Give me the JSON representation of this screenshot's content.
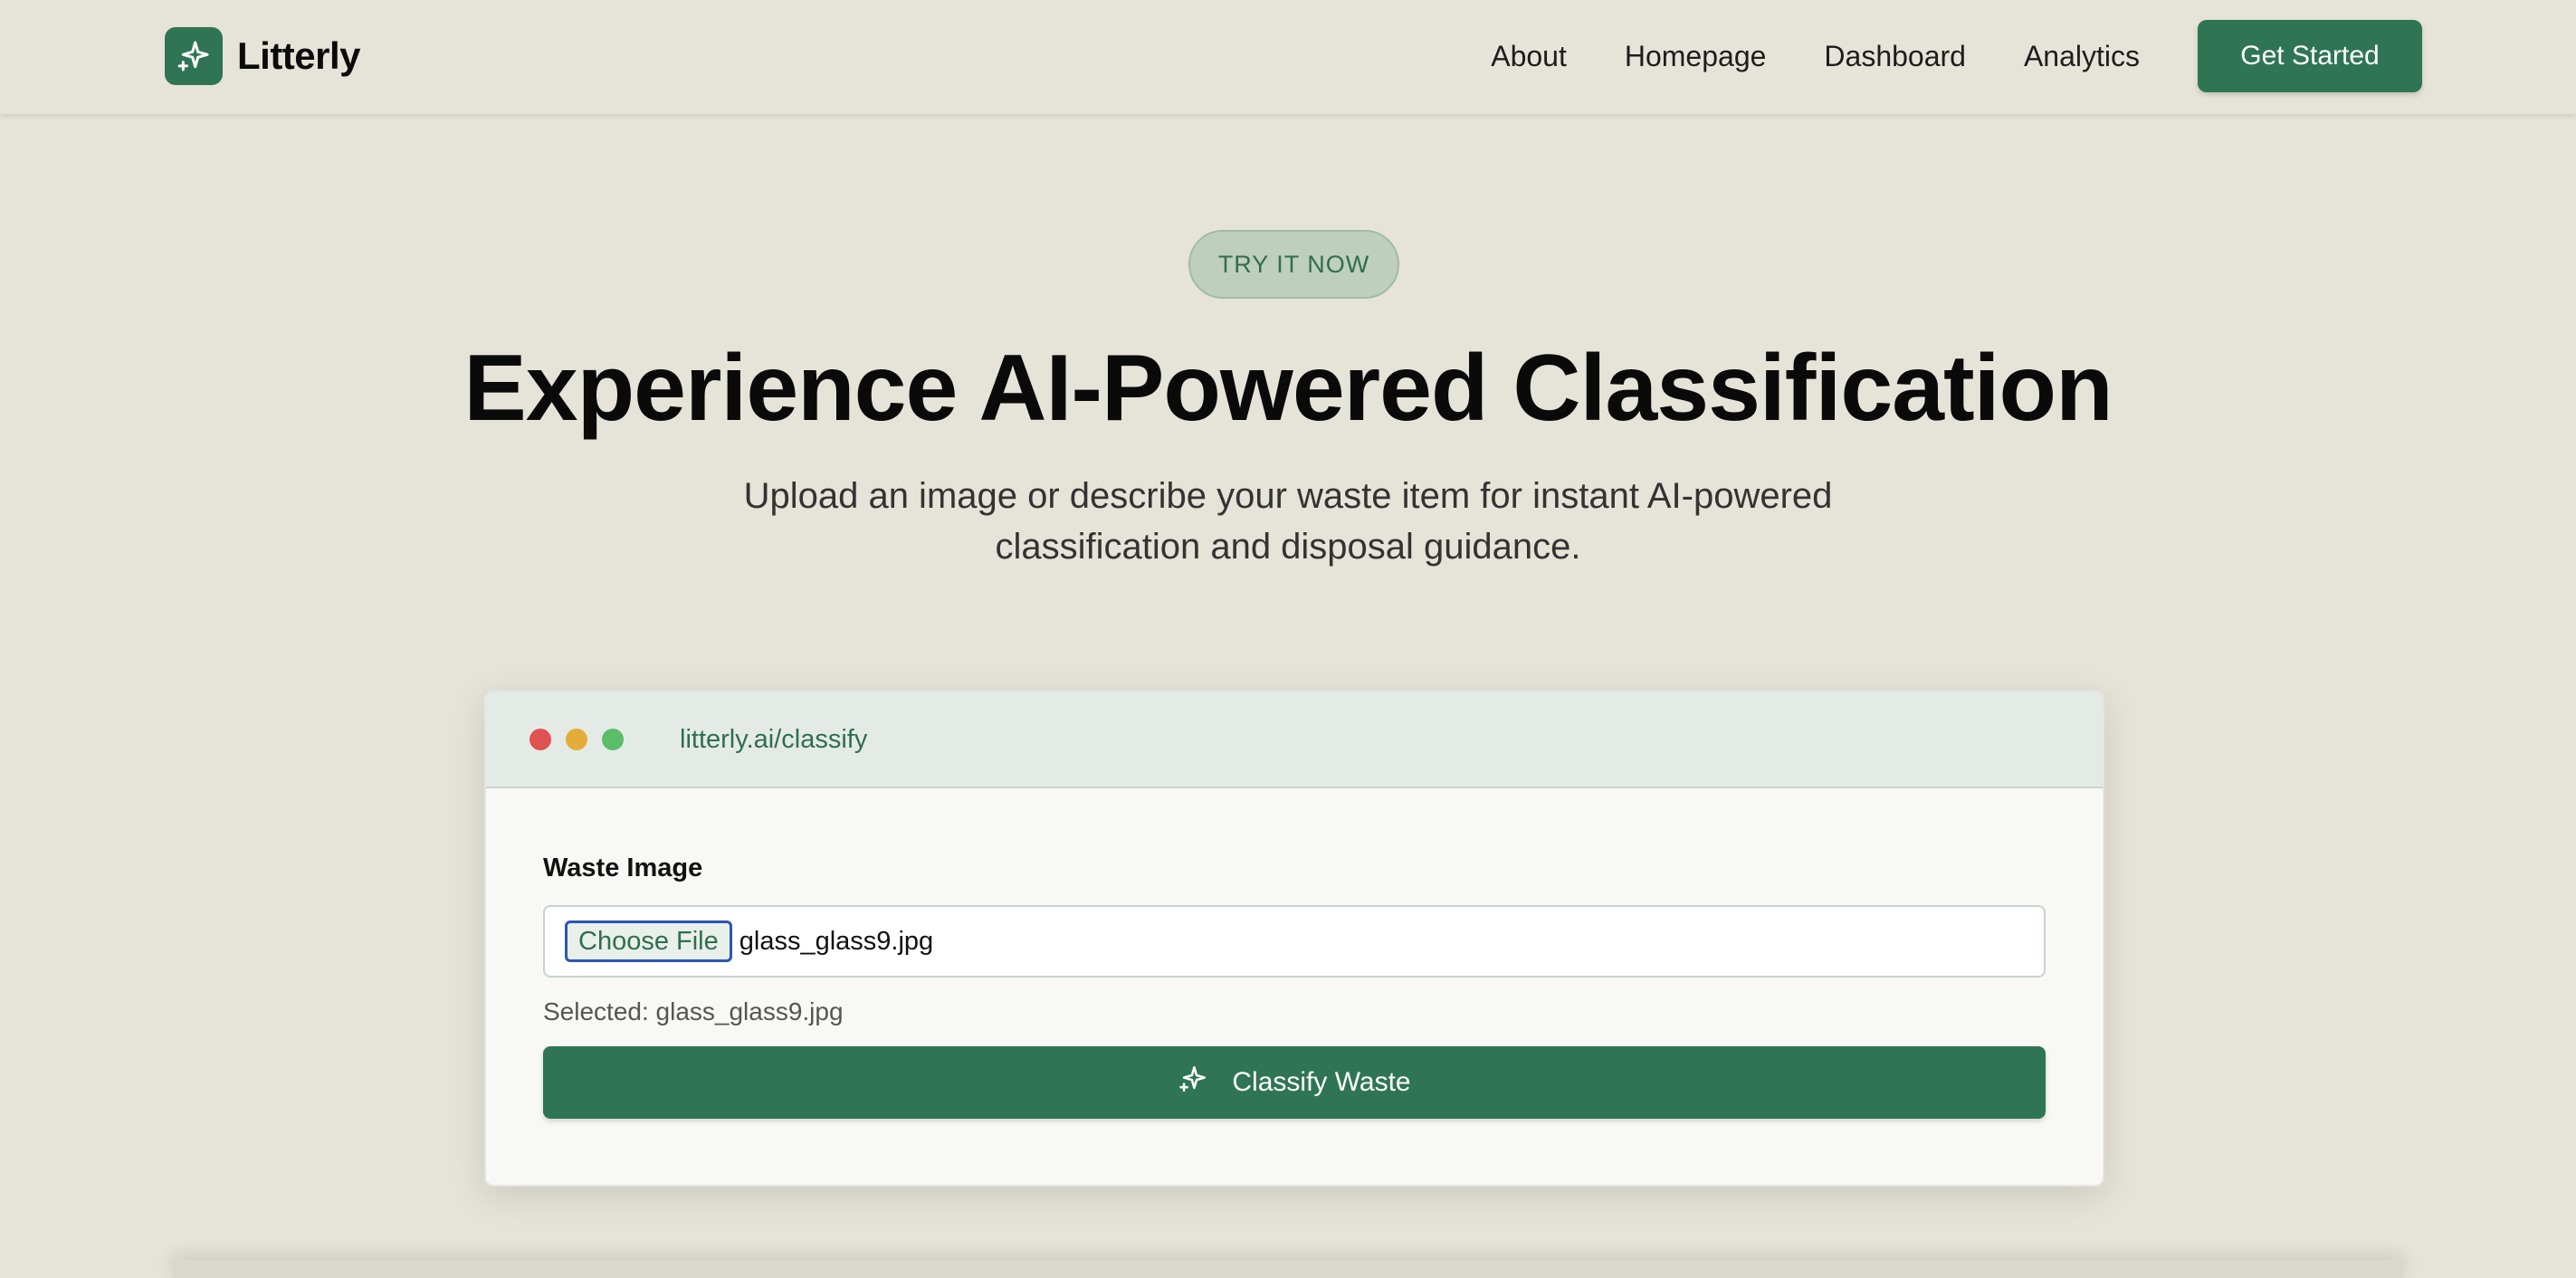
{
  "header": {
    "brand": "Litterly",
    "nav": [
      "About",
      "Homepage",
      "Dashboard",
      "Analytics"
    ],
    "cta_label": "Get Started"
  },
  "hero": {
    "badge": "TRY IT NOW",
    "title": "Experience AI-Powered Classification",
    "subtitle": "Upload an image or describe your waste item for instant AI-powered classification and disposal guidance."
  },
  "demo": {
    "url": "litterly.ai/classify",
    "field_label": "Waste Image",
    "choose_file_label": "Choose File",
    "file_name": "glass_glass9.jpg",
    "selected_text": "Selected: glass_glass9.jpg",
    "classify_label": "Classify Waste"
  },
  "icons": {
    "logo": "sparkles-icon",
    "classify": "sparkles-icon"
  },
  "colors": {
    "accent": "#2f7555",
    "background": "#e6e3d8",
    "badge_bg": "#bfcfbd"
  }
}
